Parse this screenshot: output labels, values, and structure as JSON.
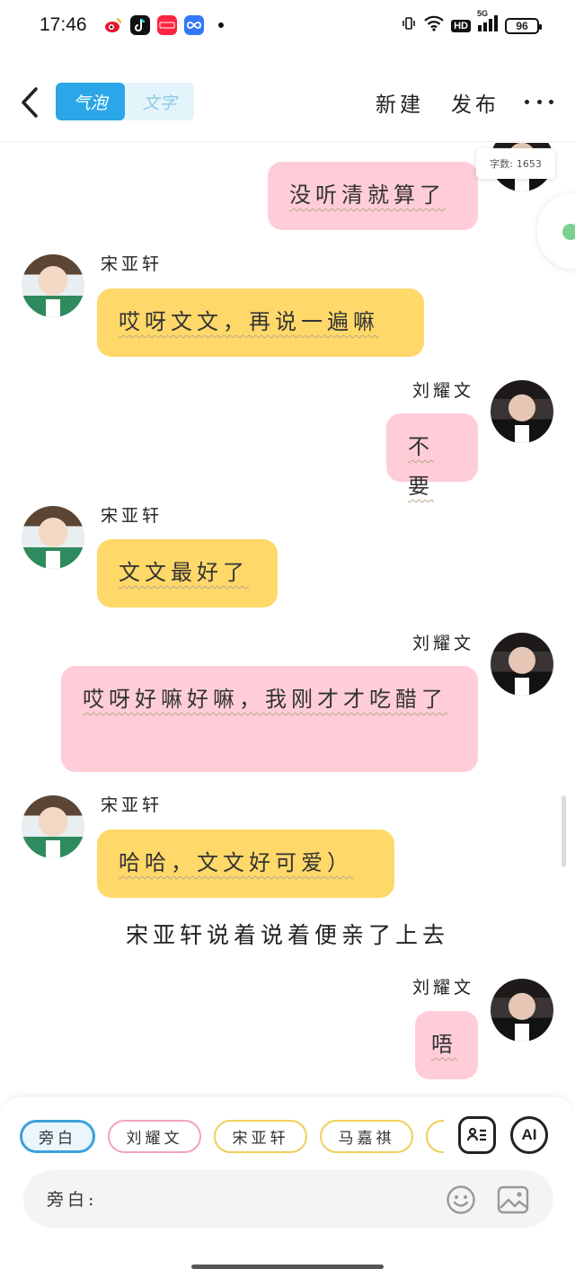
{
  "status_bar": {
    "time": "17:46",
    "app_icons": [
      "weibo-icon",
      "tiktok-icon",
      "xiaohongshu-icon",
      "infinity-app-icon"
    ],
    "network": "5G",
    "hd_label": "HD",
    "battery": "96"
  },
  "header": {
    "tabs": [
      {
        "label": "气泡",
        "active": true
      },
      {
        "label": "文字",
        "active": false
      }
    ],
    "new_label": "新建",
    "publish_label": "发布"
  },
  "word_count": {
    "label": "字数:",
    "value": "1653"
  },
  "messages": [
    {
      "side": "right",
      "sender": "刘耀文",
      "text": "没听清就算了",
      "color": "#ffcdd8"
    },
    {
      "side": "left",
      "sender": "宋亚轩",
      "text": "哎呀文文，再说一遍嘛",
      "color": "#ffd86a"
    },
    {
      "side": "right",
      "sender": "刘耀文",
      "text": "不要",
      "color": "#ffcdd8"
    },
    {
      "side": "left",
      "sender": "宋亚轩",
      "text": "文文最好了",
      "color": "#ffd86a"
    },
    {
      "side": "right",
      "sender": "刘耀文",
      "text": "哎呀好嘛好嘛，我刚才才吃醋了",
      "color": "#ffcdd8"
    },
    {
      "side": "left",
      "sender": "宋亚轩",
      "text": "哈哈，文文好可爱）",
      "color": "#ffd86a"
    },
    {
      "type": "narration",
      "text": "宋亚轩说着说着便亲了上去"
    },
    {
      "side": "right",
      "sender": "刘耀文",
      "text": "唔",
      "color": "#ffcdd8"
    }
  ],
  "composer": {
    "role_chips": [
      {
        "label": "旁白",
        "border": "#3da1dd",
        "selected": true
      },
      {
        "label": "刘耀文",
        "border": "#f2a4b8",
        "selected": false
      },
      {
        "label": "宋亚轩",
        "border": "#f0cf5a",
        "selected": false
      },
      {
        "label": "马嘉祺",
        "border": "#f0cf5a",
        "selected": false
      }
    ],
    "ai_label": "AI",
    "input_prefix": "旁白:"
  }
}
